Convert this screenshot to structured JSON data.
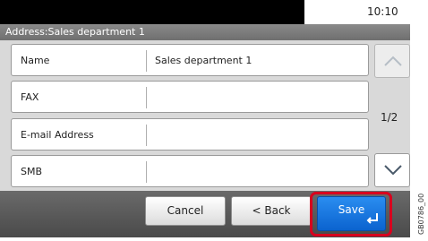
{
  "status_bar": {
    "time": "10:10"
  },
  "title_bar": {
    "title": "Address:Sales department 1"
  },
  "rows": [
    {
      "label": "Name",
      "value": "Sales department 1"
    },
    {
      "label": "FAX",
      "value": ""
    },
    {
      "label": "E-mail Address",
      "value": ""
    },
    {
      "label": "SMB",
      "value": ""
    }
  ],
  "pagination": {
    "indicator": "1/2"
  },
  "buttons": {
    "cancel": "Cancel",
    "back": "< Back",
    "save": "Save"
  },
  "side_code": "GB0786_00",
  "colors": {
    "accent": "#0b63cf",
    "highlight": "#d8001e"
  },
  "icons": {
    "scroll_up": "chevron-up-icon",
    "scroll_down": "chevron-down-icon",
    "enter": "enter-icon"
  }
}
